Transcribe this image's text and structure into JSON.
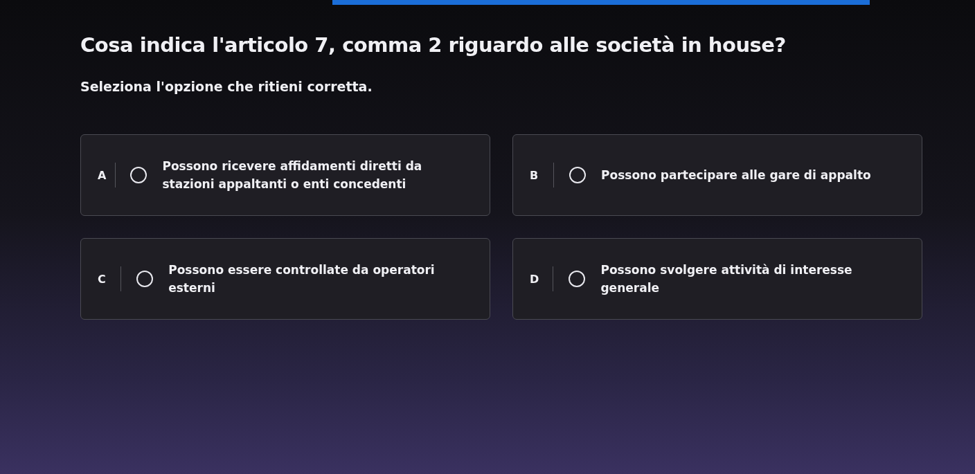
{
  "question": {
    "title": "Cosa indica l'articolo 7, comma 2 riguardo alle società in house?",
    "instruction": "Seleziona l'opzione che ritieni corretta."
  },
  "options": [
    {
      "letter": "A",
      "text": "Possono ricevere affidamenti diretti da stazioni appaltanti o enti concedenti",
      "selected": false
    },
    {
      "letter": "B",
      "text": "Possono partecipare alle gare di appalto",
      "selected": false
    },
    {
      "letter": "C",
      "text": "Possono essere controllate da operatori esterni",
      "selected": false
    },
    {
      "letter": "D",
      "text": "Possono svolgere attività di interesse generale",
      "selected": false
    }
  ]
}
